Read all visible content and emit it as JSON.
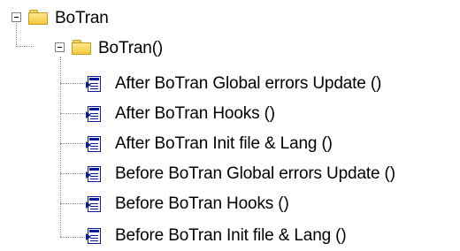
{
  "tree": {
    "root": {
      "label": "BoTran",
      "icon": "folder-icon",
      "expanded": true
    },
    "child": {
      "label": "BoTran()",
      "icon": "folder-icon",
      "expanded": true
    },
    "items": [
      {
        "label": "After BoTran Global errors Update ()",
        "icon": "method-icon"
      },
      {
        "label": "After BoTran Hooks ()",
        "icon": "method-icon"
      },
      {
        "label": "After BoTran Init file & Lang ()",
        "icon": "method-icon"
      },
      {
        "label": "Before BoTran Global errors Update ()",
        "icon": "method-icon"
      },
      {
        "label": "Before BoTran Hooks ()",
        "icon": "method-icon"
      },
      {
        "label": "Before BoTran Init file & Lang ()",
        "icon": "method-icon"
      }
    ]
  },
  "colors": {
    "folder": "#f3c93b",
    "method_icon": "#0a1a9c",
    "connector": "#8a8a8a"
  }
}
